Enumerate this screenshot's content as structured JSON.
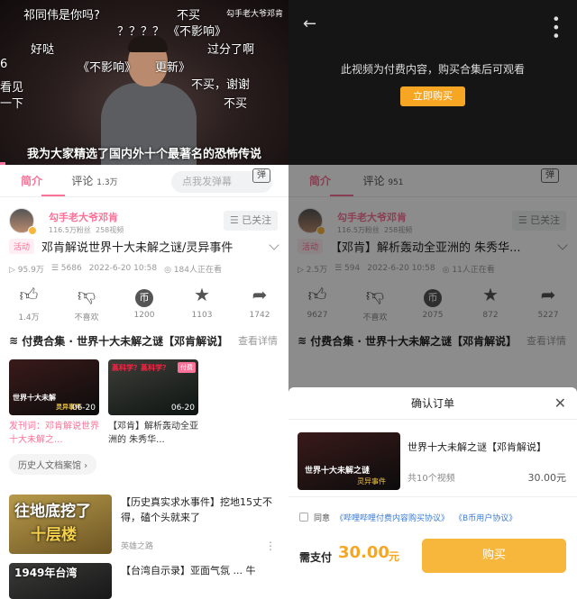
{
  "left": {
    "danmaku": [
      "祁同伟是你吗?",
      "不买",
      "？？？？",
      "《不影响》",
      "好哒",
      "过分了啊",
      "6",
      "《不影响》",
      "更新》",
      "不买，谢谢",
      "看见",
      "一下",
      "不买"
    ],
    "watermark": "勾手老大爷邓肯",
    "subtitle": "我为大家精选了国内外十个最著名的恐怖传说",
    "tabs": {
      "intro": "简介",
      "comments": "评论",
      "comment_count": "1.3万"
    },
    "danmaku_input_placeholder": "点我发弹幕",
    "danmaku_btn": "弹",
    "uploader": {
      "name": "勾手老大爷邓肯",
      "fans": "116.5万粉丝",
      "videos": "258视频",
      "follow": "☰ 已关注"
    },
    "tag": "活动",
    "title": "邓肯解说世界十大未解之谜/灵异事件",
    "stats": {
      "views": "95.9万",
      "danmaku": "5686",
      "date": "2022-6-20 10:58",
      "watching": "184人正在看"
    },
    "actions": [
      {
        "label": "1.4万",
        "icon": "thumb-up"
      },
      {
        "label": "不喜欢",
        "icon": "thumb-down"
      },
      {
        "label": "1200",
        "icon": "coin"
      },
      {
        "label": "1103",
        "icon": "star"
      },
      {
        "label": "1742",
        "icon": "share"
      }
    ],
    "series": {
      "title": "付费合集 · 世界十大未解之谜【邓肯解说】",
      "more": "查看详情"
    },
    "cards": [
      {
        "thumb_text": "世界十大未解",
        "thumb_tag": "灵异事件",
        "duration": "06-20",
        "title": "发刊词：邓肯解说世界十大未解之..."
      },
      {
        "thumb_text": "蒸科学？蒸科学？",
        "paid": "付费",
        "duration": "06-20",
        "title": "【邓肯】解析轰动全亚洲的 朱秀华..."
      }
    ],
    "archive": "历史人文档案馆 ›",
    "rec1": {
      "thumb": "往地底挖了",
      "thumb2": "十层楼",
      "title": "【历史真实求水事件】挖地15丈不得，磕个头就来了",
      "author": "英雄之路"
    },
    "rec2": {
      "thumb": "1949年台湾",
      "title": "【台湾自示录】亚面气氛 ... 牛"
    }
  },
  "right": {
    "notice": "此视频为付费内容，购买合集后可观看",
    "buy_now": "立即购买",
    "tabs": {
      "intro": "简介",
      "comments": "评论",
      "comment_count": "951"
    },
    "uploader": {
      "name": "勾手老大爷邓肯",
      "fans": "116.5万粉丝",
      "videos": "258视频",
      "follow": "☰ 已关注"
    },
    "tag": "活动",
    "title": "【邓肯】解析轰动全亚洲的 朱秀华...",
    "stats": {
      "views": "2.5万",
      "danmaku": "594",
      "date": "2022-6-20 10:58",
      "watching": "11人正在看"
    },
    "actions": [
      "9627",
      "不喜欢",
      "2075",
      "872",
      "5227"
    ],
    "series": {
      "title": "付费合集 · 世界十大未解之谜【邓肯解说】",
      "more": "查看详情"
    },
    "order": {
      "title": "确认订单",
      "close": "✕",
      "item_title": "世界十大未解之谜【邓肯解说】",
      "thumb_text": "世界十大未解之谜",
      "thumb_tag": "灵异事件",
      "count": "共10个视频",
      "price": "30.00元",
      "agree_text": "同意",
      "agree_link1": "《哔哩哔哩付费内容购买协议》",
      "agree_link2": "《B币用户协议》",
      "pay_label": "需支付",
      "pay_amount": "30.00",
      "pay_unit": "元",
      "pay_button": "购买"
    }
  },
  "colors": {
    "accent": "#fb7299",
    "pay": "#f6a623"
  },
  "progress_fraction": 0.02
}
